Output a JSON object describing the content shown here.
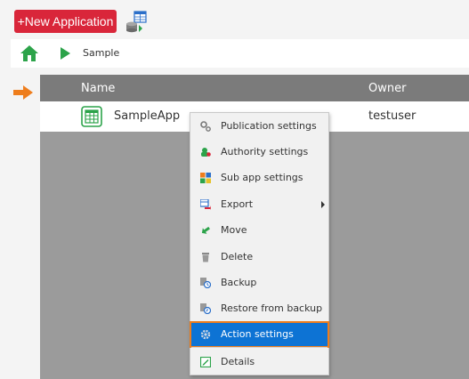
{
  "toolbar": {
    "new_app_label": "+New Application",
    "import_icon": "table-import-icon"
  },
  "breadcrumb": {
    "home_icon": "home-icon",
    "current": "Sample"
  },
  "grid": {
    "columns": {
      "name": "Name",
      "owner": "Owner"
    },
    "rows": [
      {
        "icon": "table-app-icon",
        "name": "SampleApp",
        "owner": "testuser"
      }
    ]
  },
  "context_menu": {
    "items": [
      {
        "label": "Publication settings",
        "icon": "gears-icon"
      },
      {
        "label": "Authority settings",
        "icon": "users-key-icon"
      },
      {
        "label": "Sub app settings",
        "icon": "sub-app-icon"
      },
      {
        "label": "Export",
        "icon": "export-icon",
        "has_submenu": true
      },
      {
        "label": "Move",
        "icon": "move-icon"
      },
      {
        "label": "Delete",
        "icon": "trash-icon"
      },
      {
        "label": "Backup",
        "icon": "backup-icon"
      },
      {
        "label": "Restore from backup",
        "icon": "restore-icon"
      },
      {
        "label": "Action settings",
        "icon": "gear-icon",
        "active": true
      },
      {
        "label": "Details",
        "icon": "details-icon"
      }
    ]
  },
  "colors": {
    "primary_button": "#d9263a",
    "menu_highlight": "#0d73d4",
    "highlight_outline": "#ee7d1c",
    "grid_header": "#7b7b7b",
    "grid_body": "#9b9b9b",
    "home_green": "#2ca34a"
  }
}
